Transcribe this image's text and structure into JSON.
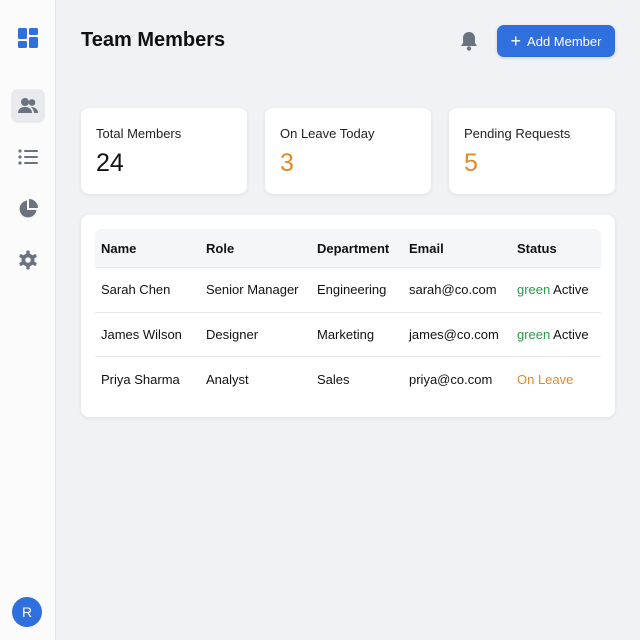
{
  "sidebar": {
    "items": [
      {
        "icon": "dashboard-icon"
      },
      {
        "icon": "users-icon",
        "active": true
      },
      {
        "icon": "list-icon"
      },
      {
        "icon": "pie-chart-icon"
      },
      {
        "icon": "settings-icon"
      }
    ],
    "avatar": "R"
  },
  "header": {
    "title": "Team Members",
    "add_label": "Add Member",
    "accent": "#2f6fde"
  },
  "stats": [
    {
      "label": "Total Members",
      "value": "24",
      "color": "#111111"
    },
    {
      "label": "On Leave Today",
      "value": "3",
      "color": "#e0892a"
    },
    {
      "label": "Pending Requests",
      "value": "5",
      "color": "#e0892a"
    }
  ],
  "table": {
    "headers": [
      "Name",
      "Role",
      "Department",
      "Email",
      "Status"
    ],
    "rows": [
      {
        "name": "Sarah Chen",
        "role": "Senior Manager",
        "department": "Engineering",
        "email": "sarah@co.com",
        "status_prefix": "green",
        "status": "Active"
      },
      {
        "name": "James Wilson",
        "role": "Designer",
        "department": "Marketing",
        "email": "james@co.com",
        "status_prefix": "green",
        "status": "Active"
      },
      {
        "name": "Priya Sharma",
        "role": "Analyst",
        "department": "Sales",
        "email": "priya@co.com",
        "status_prefix": "",
        "status": "On Leave"
      }
    ]
  }
}
